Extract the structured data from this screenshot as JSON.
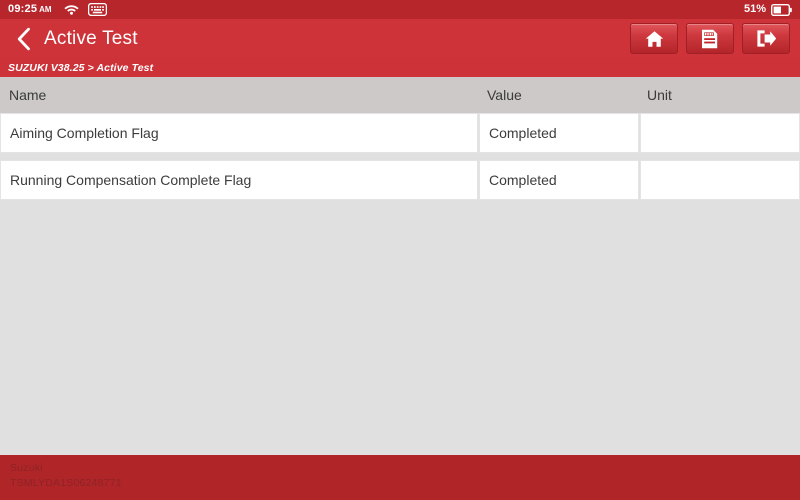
{
  "statusbar": {
    "time": "09:25",
    "ampm": "AM",
    "wifi_icon": "wifi-icon",
    "keyboard_icon": "keyboard-icon",
    "battery_percent": "51%",
    "battery_icon": "battery-icon"
  },
  "titlebar": {
    "back_icon": "chevron-left-icon",
    "title": "Active Test",
    "buttons": [
      {
        "name": "home-button",
        "icon": "home-icon"
      },
      {
        "name": "report-button",
        "icon": "report-icon"
      },
      {
        "name": "exit-button",
        "icon": "exit-icon"
      }
    ]
  },
  "breadcrumb": {
    "text": "SUZUKI V38.25 > Active Test"
  },
  "table": {
    "headers": {
      "name": "Name",
      "value": "Value",
      "unit": "Unit"
    },
    "rows": [
      {
        "name": "Aiming Completion Flag",
        "value": "Completed",
        "unit": ""
      },
      {
        "name": "Running Compensation Complete Flag",
        "value": "Completed",
        "unit": ""
      }
    ]
  },
  "footer": {
    "make": "Suzuki",
    "vin": "TSMLYDA1S06248771"
  },
  "colors": {
    "statusbar_red": "#b7262b",
    "titlebar_red": "#ce3339",
    "breadcrumb_red": "#cc3238",
    "footer_red": "#b02528",
    "content_gray": "#e0e0e0",
    "header_gray": "#cdc9c9"
  }
}
